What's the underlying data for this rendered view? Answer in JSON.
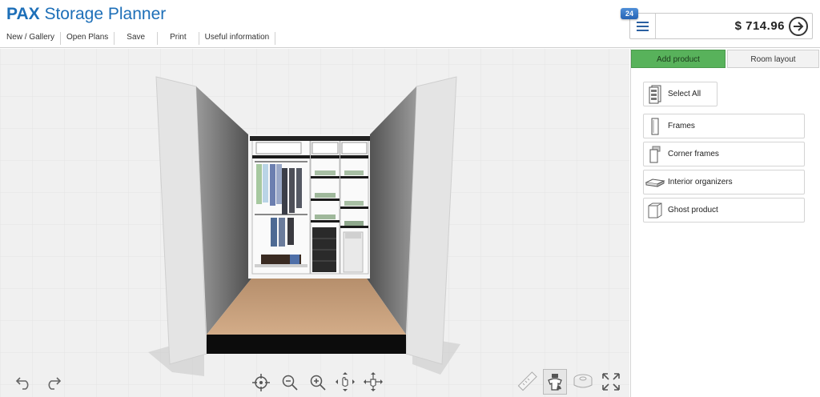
{
  "app": {
    "title_bold": "PAX",
    "title_rest": "Storage Planner"
  },
  "menu": [
    {
      "label": "New / Gallery"
    },
    {
      "label": "Open Plans"
    },
    {
      "label": "Save"
    },
    {
      "label": "Print"
    },
    {
      "label": "Useful information"
    }
  ],
  "cart": {
    "badge_count": "24",
    "price": "$ 714.96",
    "list_icon": "list-icon",
    "go_icon": "arrow-right-circle-icon"
  },
  "tabs": {
    "add_product": "Add product",
    "room_layout": "Room layout",
    "active": "add_product",
    "active_color": "#58b25b"
  },
  "products": [
    {
      "label": "Select All",
      "icon": "select-all-icon"
    },
    {
      "label": "Frames",
      "icon": "frame-icon"
    },
    {
      "label": "Corner frames",
      "icon": "corner-frame-icon"
    },
    {
      "label": "Interior organizers",
      "icon": "interior-organizer-icon"
    },
    {
      "label": "Ghost product",
      "icon": "ghost-product-icon"
    }
  ],
  "viewport_tools": {
    "left": [
      "undo-icon",
      "redo-icon"
    ],
    "center": [
      "center-view-icon",
      "zoom-out-icon",
      "zoom-in-icon",
      "rotate-icon",
      "pan-icon"
    ],
    "right": [
      "measure-icon",
      "show-contents-icon",
      "tape-icon",
      "fullscreen-icon"
    ]
  },
  "colors": {
    "brand_blue": "#1d6fb8",
    "floor": "#c8a07e",
    "wall_dark": "#6e6e6e"
  }
}
